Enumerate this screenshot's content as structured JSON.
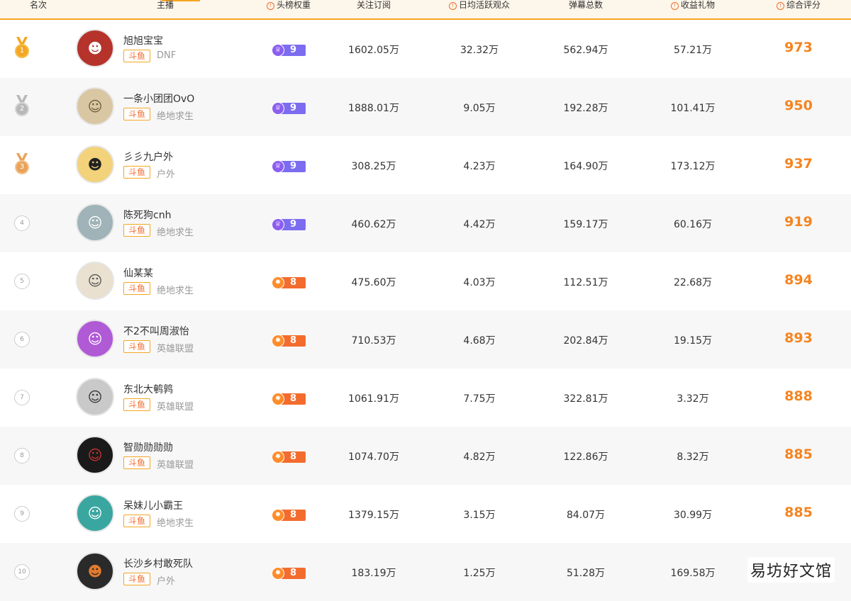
{
  "columns": {
    "rank": "名次",
    "streamer": "主播",
    "weight": "头榜权重",
    "subs": "关注订阅",
    "viewers": "日均活跃观众",
    "danmaku": "弹幕总数",
    "gifts": "收益礼物",
    "score": "综合评分",
    "info_icon": "!"
  },
  "colors": {
    "accent": "#f5a623",
    "score": "#f5841f",
    "gold": "#f5a623",
    "silver": "#b8b8b8",
    "bronze": "#e8a35a",
    "weight_purple": "#7b6cf0",
    "weight_orange": "#f36c2e"
  },
  "rows": [
    {
      "rank": "1",
      "name": "旭旭宝宝",
      "platform": "斗鱼",
      "category": "DNF",
      "weight": "9",
      "subs": "1602.05万",
      "viewers": "32.32万",
      "danmaku": "562.94万",
      "gifts": "57.21万",
      "score": "973"
    },
    {
      "rank": "2",
      "name": "一条小团团OvO",
      "platform": "斗鱼",
      "category": "绝地求生",
      "weight": "9",
      "subs": "1888.01万",
      "viewers": "9.05万",
      "danmaku": "192.28万",
      "gifts": "101.41万",
      "score": "950"
    },
    {
      "rank": "3",
      "name": "彡彡九户外",
      "platform": "斗鱼",
      "category": "户外",
      "weight": "9",
      "subs": "308.25万",
      "viewers": "4.23万",
      "danmaku": "164.90万",
      "gifts": "173.12万",
      "score": "937"
    },
    {
      "rank": "4",
      "name": "陈死狗cnh",
      "platform": "斗鱼",
      "category": "绝地求生",
      "weight": "9",
      "subs": "460.62万",
      "viewers": "4.42万",
      "danmaku": "159.17万",
      "gifts": "60.16万",
      "score": "919"
    },
    {
      "rank": "5",
      "name": "仙某某",
      "platform": "斗鱼",
      "category": "绝地求生",
      "weight": "8",
      "subs": "475.60万",
      "viewers": "4.03万",
      "danmaku": "112.51万",
      "gifts": "22.68万",
      "score": "894"
    },
    {
      "rank": "6",
      "name": "不2不叫周淑怡",
      "platform": "斗鱼",
      "category": "英雄联盟",
      "weight": "8",
      "subs": "710.53万",
      "viewers": "4.68万",
      "danmaku": "202.84万",
      "gifts": "19.15万",
      "score": "893"
    },
    {
      "rank": "7",
      "name": "东北大鹌鹑",
      "platform": "斗鱼",
      "category": "英雄联盟",
      "weight": "8",
      "subs": "1061.91万",
      "viewers": "7.75万",
      "danmaku": "322.81万",
      "gifts": "3.32万",
      "score": "888"
    },
    {
      "rank": "8",
      "name": "智勋勋勋勋",
      "platform": "斗鱼",
      "category": "英雄联盟",
      "weight": "8",
      "subs": "1074.70万",
      "viewers": "4.82万",
      "danmaku": "122.86万",
      "gifts": "8.32万",
      "score": "885"
    },
    {
      "rank": "9",
      "name": "呆妹儿小霸王",
      "platform": "斗鱼",
      "category": "绝地求生",
      "weight": "8",
      "subs": "1379.15万",
      "viewers": "3.15万",
      "danmaku": "84.07万",
      "gifts": "30.99万",
      "score": "885"
    },
    {
      "rank": "10",
      "name": "长沙乡村敢死队",
      "platform": "斗鱼",
      "category": "户外",
      "weight": "8",
      "subs": "183.19万",
      "viewers": "1.25万",
      "danmaku": "51.28万",
      "gifts": "169.58万",
      "score": ""
    }
  ],
  "watermark": "易坊好文馆"
}
